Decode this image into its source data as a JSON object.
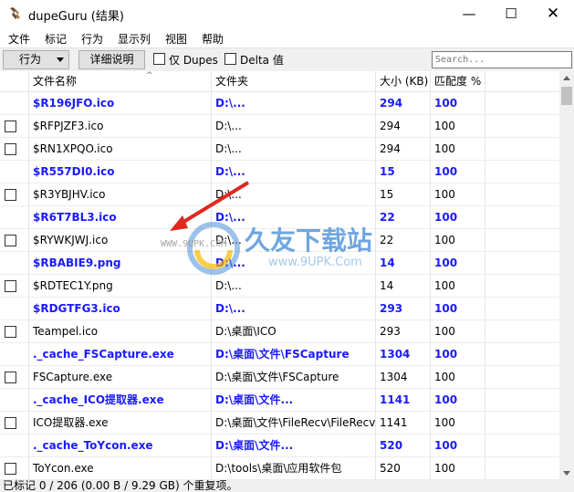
{
  "window": {
    "title": "dupeGuru (结果)",
    "minimize": "—",
    "maximize": "☐",
    "close": "✕"
  },
  "menu": [
    "文件",
    "标记",
    "行为",
    "显示列",
    "视图",
    "帮助"
  ],
  "toolbar": {
    "action_label": "行为",
    "detail_label": "详细说明",
    "dupes_label": "仅 Dupes",
    "delta_label": "Delta 值",
    "search_placeholder": "Search..."
  },
  "table": {
    "columns": [
      "文件名称",
      "文件夹",
      "大小 (KB)",
      "匹配度 %"
    ],
    "rows": [
      {
        "ref": true,
        "name": "$R196JFO.ico",
        "folder": "D:\\...",
        "size": "294",
        "match": "100"
      },
      {
        "ref": false,
        "name": "$RFPJZF3.ico",
        "folder": "D:\\...",
        "size": "294",
        "match": "100"
      },
      {
        "ref": false,
        "name": "$RN1XPQO.ico",
        "folder": "D:\\...",
        "size": "294",
        "match": "100"
      },
      {
        "ref": true,
        "name": "$R557DI0.ico",
        "folder": "D:\\...",
        "size": "15",
        "match": "100"
      },
      {
        "ref": false,
        "name": "$R3YBJHV.ico",
        "folder": "D:\\...",
        "size": "15",
        "match": "100"
      },
      {
        "ref": true,
        "name": "$R6T7BL3.ico",
        "folder": "D:\\...",
        "size": "22",
        "match": "100"
      },
      {
        "ref": false,
        "name": "$RYWKJWJ.ico",
        "folder": "D:\\...",
        "size": "22",
        "match": "100"
      },
      {
        "ref": true,
        "name": "$RBABIE9.png",
        "folder": "D:\\...",
        "size": "14",
        "match": "100"
      },
      {
        "ref": false,
        "name": "$RDTEC1Y.png",
        "folder": "D:\\...",
        "size": "14",
        "match": "100"
      },
      {
        "ref": true,
        "name": "$RDGTFG3.ico",
        "folder": "D:\\...",
        "size": "293",
        "match": "100"
      },
      {
        "ref": false,
        "name": "Teampel.ico",
        "folder": "D:\\桌面\\ICO",
        "size": "293",
        "match": "100"
      },
      {
        "ref": true,
        "name": "._cache_FSCapture.exe",
        "folder": "D:\\桌面\\文件\\FSCapture",
        "size": "1304",
        "match": "100"
      },
      {
        "ref": false,
        "name": "FSCapture.exe",
        "folder": "D:\\桌面\\文件\\FSCapture",
        "size": "1304",
        "match": "100"
      },
      {
        "ref": true,
        "name": "._cache_ICO提取器.exe",
        "folder": "D:\\桌面\\文件...",
        "size": "1141",
        "match": "100"
      },
      {
        "ref": false,
        "name": "ICO提取器.exe",
        "folder": "D:\\桌面\\文件\\FileRecv\\FileRecv",
        "size": "1141",
        "match": "100"
      },
      {
        "ref": true,
        "name": "._cache_ToYcon.exe",
        "folder": "D:\\桌面\\文件...",
        "size": "520",
        "match": "100"
      },
      {
        "ref": false,
        "name": "ToYcon.exe",
        "folder": "D:\\tools\\桌面\\应用软件包",
        "size": "520",
        "match": "100"
      }
    ]
  },
  "status": "已标记 0 / 206 (0.00 B / 9.29 GB) 个重复项。",
  "watermark": {
    "brand": "久友下载站",
    "url": "www.9UPK.Com",
    "url_small": "WWW.9UPK.COM"
  },
  "colors": {
    "reference_row_text": "#1a1aff",
    "watermark_red": "#e0281e"
  }
}
